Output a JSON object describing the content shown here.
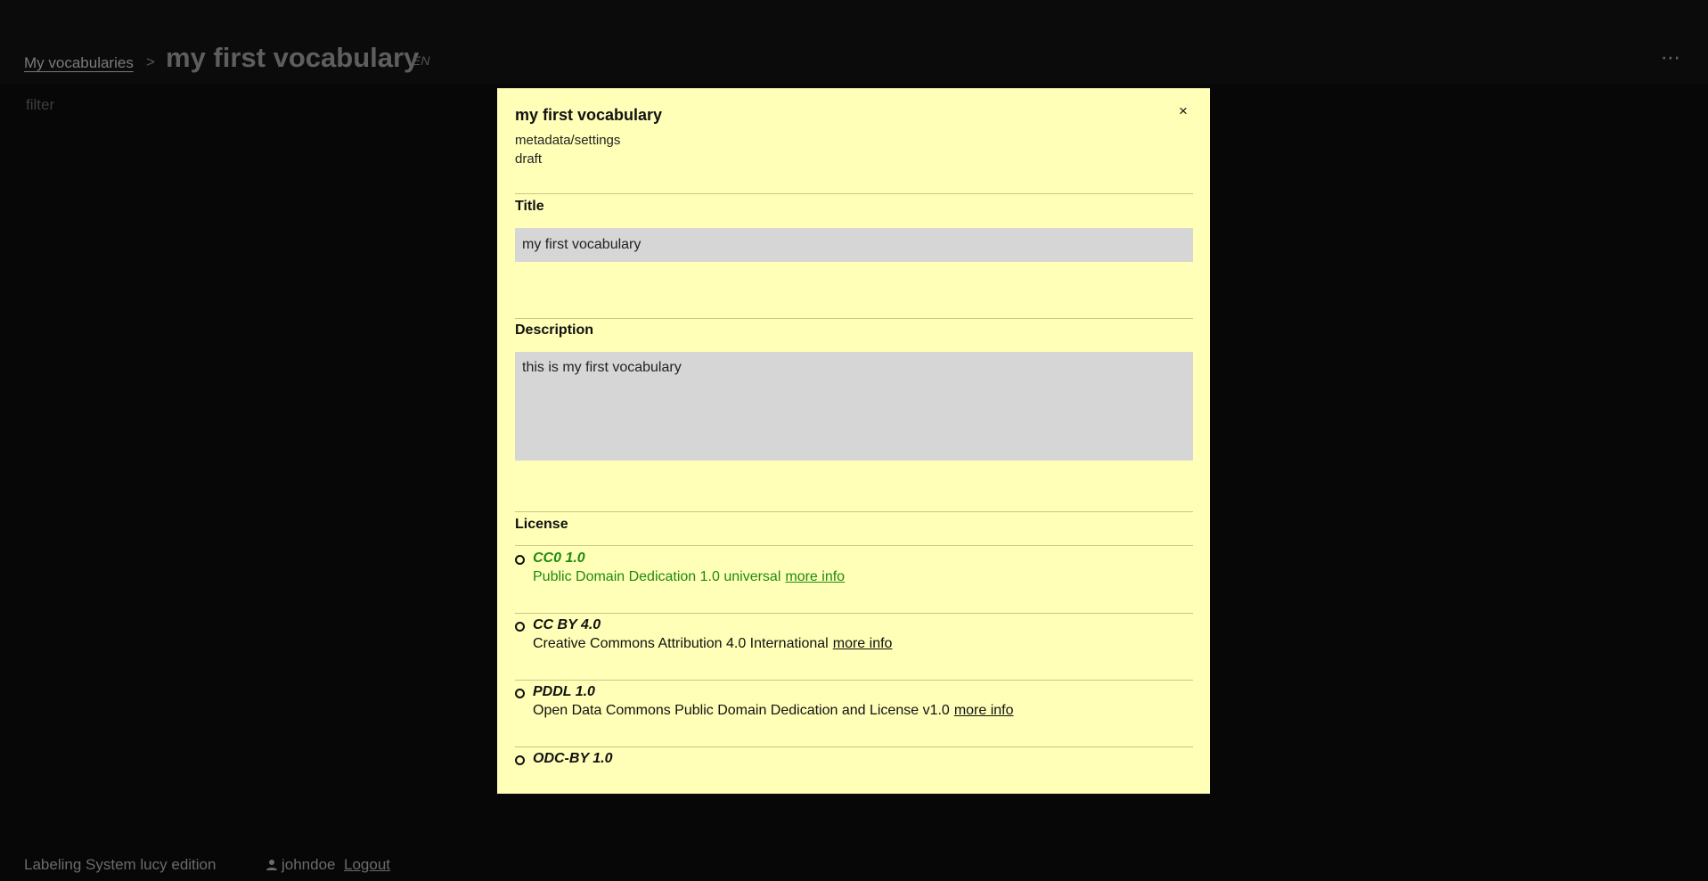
{
  "header": {
    "breadcrumb": "My vocabularies",
    "separator": ">",
    "title": "my first vocabulary",
    "language": "EN",
    "menu_icon": "⋯"
  },
  "filter": {
    "placeholder": "filter"
  },
  "footer": {
    "app_name": "Labeling System lucy edition",
    "username": "johndoe",
    "logout": "Logout"
  },
  "modal": {
    "title": "my first vocabulary",
    "close": "×",
    "subtitle": "metadata/settings",
    "status": "draft",
    "title_label": "Title",
    "title_value": "my first vocabulary",
    "description_label": "Description",
    "description_value": "this is my first vocabulary",
    "license_label": "License",
    "licenses": [
      {
        "name": "CC0 1.0",
        "description": "Public Domain Dedication 1.0 universal",
        "link": "more info",
        "highlighted": true
      },
      {
        "name": "CC BY 4.0",
        "description": "Creative Commons Attribution 4.0 International",
        "link": "more info"
      },
      {
        "name": "PDDL 1.0",
        "description": "Open Data Commons Public Domain Dedication and License v1.0",
        "link": "more info"
      },
      {
        "name": "ODC-BY 1.0"
      }
    ]
  },
  "colors": {
    "modal_bg": "#ffffb8",
    "input_bg": "#d6d6d6",
    "accent_green": "#1f8a0f",
    "page_bg": "#070707"
  }
}
